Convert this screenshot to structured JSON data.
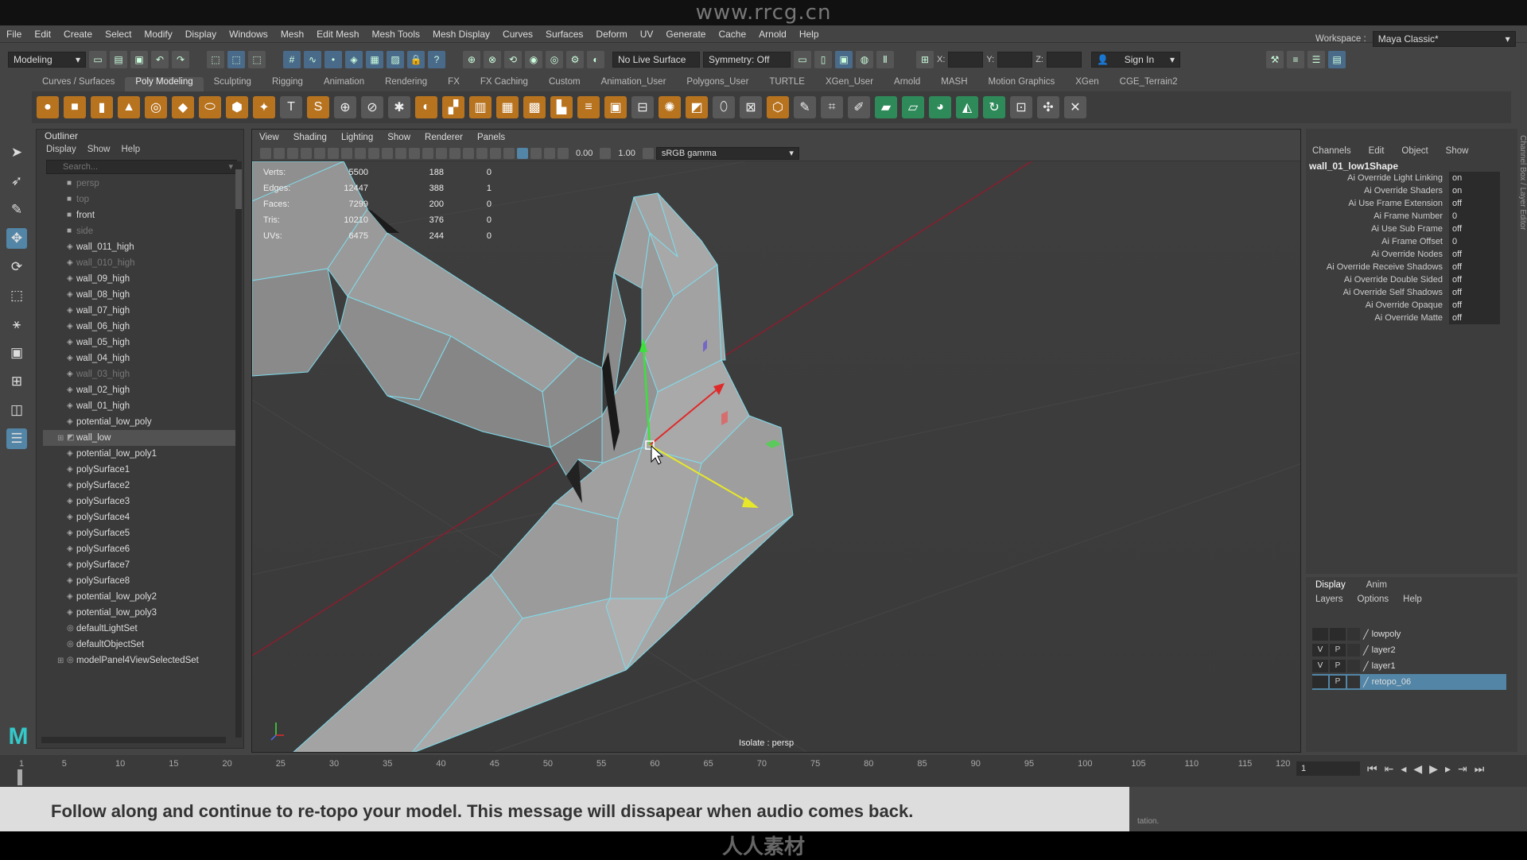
{
  "watermark_top": "www.rrcg.cn",
  "watermark_bottom": "人人素材",
  "menu": [
    "File",
    "Edit",
    "Create",
    "Select",
    "Modify",
    "Display",
    "Windows",
    "Mesh",
    "Edit Mesh",
    "Mesh Tools",
    "Mesh Display",
    "Curves",
    "Surfaces",
    "Deform",
    "UV",
    "Generate",
    "Cache",
    "Arnold",
    "Help"
  ],
  "workspace": {
    "label": "Workspace :",
    "value": "Maya Classic*"
  },
  "status": {
    "mode": "Modeling",
    "live_surface": "No Live Surface",
    "symmetry": "Symmetry: Off",
    "sign_in": "Sign In",
    "x_label": "X:",
    "y_label": "Y:",
    "z_label": "Z:"
  },
  "shelf_tabs": [
    "Curves / Surfaces",
    "Poly Modeling",
    "Sculpting",
    "Rigging",
    "Animation",
    "Rendering",
    "FX",
    "FX Caching",
    "Custom",
    "Animation_User",
    "Polygons_User",
    "TURTLE",
    "XGen_User",
    "Arnold",
    "MASH",
    "Motion Graphics",
    "XGen",
    "CGE_Terrain2"
  ],
  "shelf_active": "Poly Modeling",
  "outliner": {
    "title": "Outliner",
    "menu": [
      "Display",
      "Show",
      "Help"
    ],
    "search_placeholder": "Search...",
    "items": [
      {
        "label": "persp",
        "dim": true,
        "icon": "camera-icon"
      },
      {
        "label": "top",
        "dim": true,
        "icon": "camera-icon"
      },
      {
        "label": "front",
        "dim": false,
        "icon": "camera-icon"
      },
      {
        "label": "side",
        "dim": true,
        "icon": "camera-icon"
      },
      {
        "label": "wall_011_high",
        "dim": false,
        "icon": "mesh-icon"
      },
      {
        "label": "wall_010_high",
        "dim": true,
        "icon": "mesh-icon"
      },
      {
        "label": "wall_09_high",
        "dim": false,
        "icon": "mesh-icon"
      },
      {
        "label": "wall_08_high",
        "dim": false,
        "icon": "mesh-icon"
      },
      {
        "label": "wall_07_high",
        "dim": false,
        "icon": "mesh-icon"
      },
      {
        "label": "wall_06_high",
        "dim": false,
        "icon": "mesh-icon"
      },
      {
        "label": "wall_05_high",
        "dim": false,
        "icon": "mesh-icon"
      },
      {
        "label": "wall_04_high",
        "dim": false,
        "icon": "mesh-icon"
      },
      {
        "label": "wall_03_high",
        "dim": true,
        "icon": "mesh-icon"
      },
      {
        "label": "wall_02_high",
        "dim": false,
        "icon": "mesh-icon"
      },
      {
        "label": "wall_01_high",
        "dim": false,
        "icon": "mesh-icon"
      },
      {
        "label": "potential_low_poly",
        "dim": false,
        "icon": "mesh-icon"
      },
      {
        "label": "wall_low",
        "dim": false,
        "icon": "group-icon",
        "expand": true,
        "highlight": true
      },
      {
        "label": "potential_low_poly1",
        "dim": false,
        "icon": "mesh-icon"
      },
      {
        "label": "polySurface1",
        "dim": false,
        "icon": "mesh-icon"
      },
      {
        "label": "polySurface2",
        "dim": false,
        "icon": "mesh-icon"
      },
      {
        "label": "polySurface3",
        "dim": false,
        "icon": "mesh-icon"
      },
      {
        "label": "polySurface4",
        "dim": false,
        "icon": "mesh-icon"
      },
      {
        "label": "polySurface5",
        "dim": false,
        "icon": "mesh-icon"
      },
      {
        "label": "polySurface6",
        "dim": false,
        "icon": "mesh-icon"
      },
      {
        "label": "polySurface7",
        "dim": false,
        "icon": "mesh-icon"
      },
      {
        "label": "polySurface8",
        "dim": false,
        "icon": "mesh-icon"
      },
      {
        "label": "potential_low_poly2",
        "dim": false,
        "icon": "mesh-icon"
      },
      {
        "label": "potential_low_poly3",
        "dim": false,
        "icon": "mesh-icon"
      },
      {
        "label": "defaultLightSet",
        "dim": false,
        "icon": "set-icon"
      },
      {
        "label": "defaultObjectSet",
        "dim": false,
        "icon": "set-icon"
      },
      {
        "label": "modelPanel4ViewSelectedSet",
        "dim": false,
        "icon": "set-icon",
        "expand": true
      }
    ]
  },
  "viewport": {
    "menu": [
      "View",
      "Shading",
      "Lighting",
      "Show",
      "Renderer",
      "Panels"
    ],
    "exposure": "0.00",
    "gamma": "1.00",
    "color_space": "sRGB gamma",
    "isolate_label": "Isolate : persp",
    "hud": [
      {
        "label": "Verts:",
        "a": "5500",
        "b": "188",
        "c": "0"
      },
      {
        "label": "Edges:",
        "a": "12447",
        "b": "388",
        "c": "1"
      },
      {
        "label": "Faces:",
        "a": "7299",
        "b": "200",
        "c": "0"
      },
      {
        "label": "Tris:",
        "a": "10210",
        "b": "376",
        "c": "0"
      },
      {
        "label": "UVs:",
        "a": "6475",
        "b": "244",
        "c": "0"
      }
    ]
  },
  "channel_box": {
    "menu": [
      "Channels",
      "Edit",
      "Object",
      "Show"
    ],
    "node": "wall_01_low1Shape",
    "attrs": [
      {
        "k": "Ai Override Light Linking",
        "v": "on"
      },
      {
        "k": "Ai Override Shaders",
        "v": "on"
      },
      {
        "k": "Ai Use Frame Extension",
        "v": "off"
      },
      {
        "k": "Ai Frame Number",
        "v": "0"
      },
      {
        "k": "Ai Use Sub Frame",
        "v": "off"
      },
      {
        "k": "Ai Frame Offset",
        "v": "0"
      },
      {
        "k": "Ai Override Nodes",
        "v": "off"
      },
      {
        "k": "Ai Override Receive Shadows",
        "v": "off"
      },
      {
        "k": "Ai Override Double Sided",
        "v": "off"
      },
      {
        "k": "Ai Override Self Shadows",
        "v": "off"
      },
      {
        "k": "Ai Override Opaque",
        "v": "off"
      },
      {
        "k": "Ai Override Matte",
        "v": "off"
      }
    ]
  },
  "layer_editor": {
    "tabs": [
      "Display",
      "Anim"
    ],
    "menu": [
      "Layers",
      "Options",
      "Help"
    ],
    "layers": [
      {
        "v": "",
        "p": "",
        "name": "lowpoly",
        "selected": false
      },
      {
        "v": "V",
        "p": "P",
        "name": "layer2",
        "selected": false
      },
      {
        "v": "V",
        "p": "P",
        "name": "layer1",
        "selected": false
      },
      {
        "v": "",
        "p": "P",
        "name": "retopo_06",
        "selected": true
      }
    ]
  },
  "side_tabs": "Channel Box / Layer Editor",
  "timeline": {
    "ticks": [
      "1",
      "5",
      "10",
      "15",
      "20",
      "25",
      "30",
      "35",
      "40",
      "45",
      "50",
      "55",
      "60",
      "65",
      "70",
      "75",
      "80",
      "85",
      "90",
      "95",
      "100",
      "105",
      "110",
      "115",
      "120"
    ],
    "current_frame": "1"
  },
  "caption": "Follow along and continue to re-topo your model. This message will dissapear when audio comes back.",
  "help_line": "tation."
}
